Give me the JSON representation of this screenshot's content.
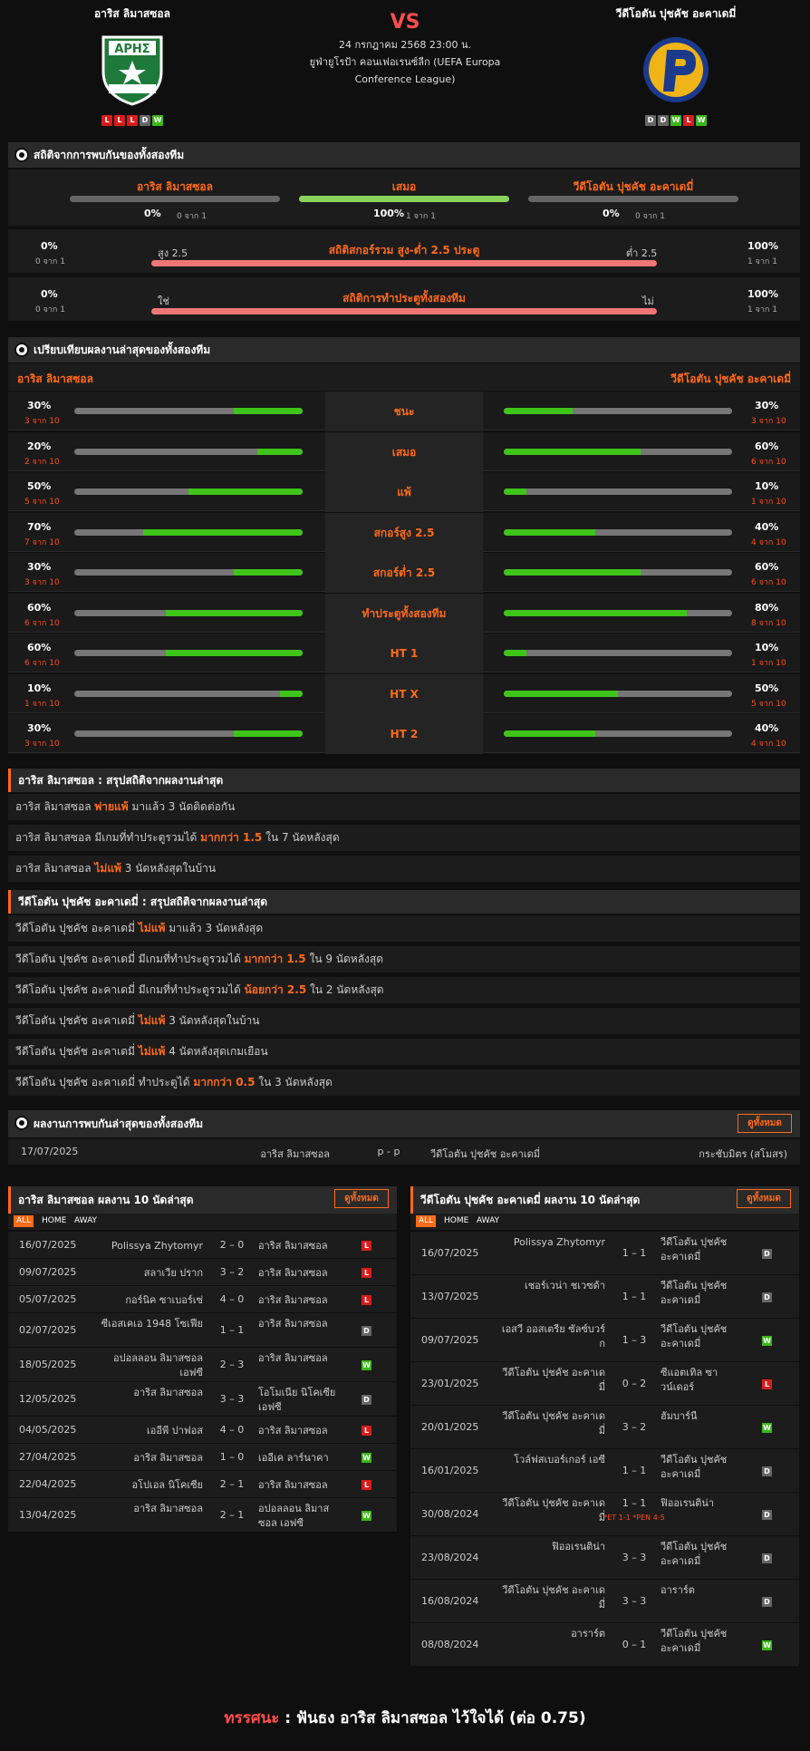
{
  "header": {
    "home": {
      "name": "อาริส ลิมาสซอล",
      "form": [
        "L",
        "L",
        "L",
        "D",
        "W"
      ]
    },
    "away": {
      "name": "วีดีโอตัน ปุชคัช อะคาเดมี่",
      "form": [
        "D",
        "D",
        "W",
        "L",
        "W"
      ]
    },
    "vs": "VS",
    "date": "24 กรกฎาคม 2568 23:00 น.",
    "league": "ยูฟ่ายูโรป้า คอนเฟอเรนซ์ลีก (UEFA Europa Conference League)"
  },
  "h2h_stats": {
    "title": "สถิติจากการพบกันของทั้งสองทีม",
    "cols": [
      {
        "label": "อาริส ลิมาสซอล",
        "pct": "0%",
        "sub": "0 จาก 1",
        "value": 0
      },
      {
        "label": "เสมอ",
        "pct": "100%",
        "sub": "1 จาก 1",
        "value": 1
      },
      {
        "label": "วีดีโอตัน ปุชคัช อะคาเดมี่",
        "pct": "0%",
        "sub": "0 จาก 1",
        "value": 0
      }
    ],
    "ou": {
      "title": "สถิติสกอร์รวม สูง-ต่ำ 2.5 ประตู",
      "left_pct": "0%",
      "left_sub": "0 จาก 1",
      "left_label": "สูง 2.5",
      "right_label": "ต่ำ 2.5",
      "right_pct": "100%",
      "right_sub": "1 จาก 1"
    },
    "btts": {
      "title": "สถิติการทำประตูทั้งสองทีม",
      "left_pct": "0%",
      "left_sub": "0 จาก 1",
      "left_label": "ใช่",
      "right_label": "ไม่",
      "right_pct": "100%",
      "right_sub": "1 จาก 1"
    }
  },
  "compare": {
    "title": "เปรียบเทียบผลงานล่าสุดของทั้งสองทีม",
    "home": "อาริส ลิมาสซอล",
    "away": "วีดีโอตัน ปุชคัช อะคาเดมี่",
    "rows": [
      {
        "label": "ชนะ",
        "home_pct": "30%",
        "home_sub": "3 จาก 10",
        "home": 0.3,
        "away_pct": "30%",
        "away_sub": "3 จาก 10",
        "away": 0.3
      },
      {
        "label": "เสมอ",
        "home_pct": "20%",
        "home_sub": "2 จาก 10",
        "home": 0.2,
        "away_pct": "60%",
        "away_sub": "6 จาก 10",
        "away": 0.6
      },
      {
        "label": "แพ้",
        "home_pct": "50%",
        "home_sub": "5 จาก 10",
        "home": 0.5,
        "away_pct": "10%",
        "away_sub": "1 จาก 10",
        "away": 0.1
      },
      {
        "label": "สกอร์สูง 2.5",
        "home_pct": "70%",
        "home_sub": "7 จาก 10",
        "home": 0.7,
        "away_pct": "40%",
        "away_sub": "4 จาก 10",
        "away": 0.4
      },
      {
        "label": "สกอร์ต่ำ 2.5",
        "home_pct": "30%",
        "home_sub": "3 จาก 10",
        "home": 0.3,
        "away_pct": "60%",
        "away_sub": "6 จาก 10",
        "away": 0.6
      },
      {
        "label": "ทำประตูทั้งสองทีม",
        "home_pct": "60%",
        "home_sub": "6 จาก 10",
        "home": 0.6,
        "away_pct": "80%",
        "away_sub": "8 จาก 10",
        "away": 0.8
      },
      {
        "label": "HT 1",
        "home_pct": "60%",
        "home_sub": "6 จาก 10",
        "home": 0.6,
        "away_pct": "10%",
        "away_sub": "1 จาก 10",
        "away": 0.1
      },
      {
        "label": "HT X",
        "home_pct": "10%",
        "home_sub": "1 จาก 10",
        "home": 0.1,
        "away_pct": "50%",
        "away_sub": "5 จาก 10",
        "away": 0.5
      },
      {
        "label": "HT 2",
        "home_pct": "30%",
        "home_sub": "3 จาก 10",
        "home": 0.3,
        "away_pct": "40%",
        "away_sub": "4 จาก 10",
        "away": 0.4
      }
    ]
  },
  "home_summary": {
    "title": "อาริส ลิมาสซอล : สรุปสถิติจากผลงานล่าสุด",
    "rows": [
      [
        "อาริส ลิมาสซอล ",
        "พ่ายแพ้",
        " มาแล้ว 3 นัดติดต่อกัน"
      ],
      [
        "อาริส ลิมาสซอล  มีเกมที่ทำประตูรวมได้ ",
        "มากกว่า 1.5",
        " ใน 7 นัดหลังสุด"
      ],
      [
        "อาริส ลิมาสซอล ",
        "ไม่แพ้",
        " 3  นัดหลังสุดในบ้าน"
      ]
    ]
  },
  "away_summary": {
    "title": "วีดีโอตัน ปุชคัช อะคาเดมี่ : สรุปสถิติจากผลงานล่าสุด",
    "rows": [
      [
        "วีดีโอตัน ปุชคัช อะคาเดมี่ ",
        "ไม่แพ้",
        " มาแล้ว 3 นัดหลังสุด"
      ],
      [
        "วีดีโอตัน ปุชคัช อะคาเดมี่  มีเกมที่ทำประตูรวมได้ ",
        "มากกว่า 1.5",
        " ใน 9 นัดหลังสุด"
      ],
      [
        "วีดีโอตัน ปุชคัช อะคาเดมี่  มีเกมที่ทำประตูรวมได้ ",
        "น้อยกว่า 2.5",
        " ใน 2 นัดหลังสุด"
      ],
      [
        "วีดีโอตัน ปุชคัช อะคาเดมี่ ",
        "ไม่แพ้",
        " 3  นัดหลังสุดในบ้าน"
      ],
      [
        "วีดีโอตัน ปุชคัช อะคาเดมี่ ",
        "ไม่แพ้",
        " 4  นัดหลังสุดเกมเยือน"
      ],
      [
        "วีดีโอตัน ปุชคัช อะคาเดมี่  ทำประตูได้ ",
        "มากกว่า 0.5",
        " ใน 3 นัดหลังสุด"
      ]
    ]
  },
  "h2h_results": {
    "title": "ผลงานการพบกันล่าสุดของทั้งสองทีม",
    "button": "ดูทั้งหมด",
    "row": {
      "date": "17/07/2025",
      "home": "อาริส ลิมาสซอล",
      "score": "p - p",
      "away": "วีดีโอตัน ปุชคัช อะคาเดมี่",
      "comp": "กระชับมิตร (สโมสร)"
    }
  },
  "home_last10": {
    "title": "อาริส ลิมาสซอล ผลงาน 10 นัดล่าสุด",
    "button": "ดูทั้งหมด",
    "tabs": [
      "ALL",
      "HOME",
      "AWAY"
    ],
    "rows": [
      {
        "date": "16/07/2025",
        "home": "Polissya Zhytomyr",
        "score": "2 – 0",
        "away": "อาริส ลิมาสซอล",
        "res": "L"
      },
      {
        "date": "09/07/2025",
        "home": "สลาเวีย ปราก",
        "score": "3 – 2",
        "away": "อาริส ลิมาสซอล",
        "res": "L"
      },
      {
        "date": "05/07/2025",
        "home": "กอร์นิค ซาเบอร์เซ่",
        "score": "4 – 0",
        "away": "อาริส ลิมาสซอล",
        "res": "L"
      },
      {
        "date": "02/07/2025",
        "home": "ซีเอสเคเอ 1948 โซเฟีย",
        "score": "1 – 1",
        "away": "อาริส ลิมาสซอล",
        "res": "D"
      },
      {
        "date": "18/05/2025",
        "home": "อปอลลอน ลิมาสซอล เอฟซี",
        "score": "2 – 3",
        "away": "อาริส ลิมาสซอล",
        "res": "W"
      },
      {
        "date": "12/05/2025",
        "home": "อาริส ลิมาสซอล",
        "score": "3 – 3",
        "away": "โอโมเนีย นิโคเซีย เอฟซี",
        "res": "D"
      },
      {
        "date": "04/05/2025",
        "home": "เออีพี ปาฟอส",
        "score": "4 – 0",
        "away": "อาริส ลิมาสซอล",
        "res": "L"
      },
      {
        "date": "27/04/2025",
        "home": "อาริส ลิมาสซอล",
        "score": "1 – 0",
        "away": "เออีเค ลาร์นาคา",
        "res": "W"
      },
      {
        "date": "22/04/2025",
        "home": "อโปเอล นิโคเซีย",
        "score": "2 – 1",
        "away": "อาริส ลิมาสซอล",
        "res": "L"
      },
      {
        "date": "13/04/2025",
        "home": "อาริส ลิมาสซอล",
        "score": "2 – 1",
        "away": "อปอลลอน ลิมาสซอล เอฟซี",
        "res": "W"
      }
    ]
  },
  "away_last10": {
    "title": "วีดีโอตัน ปุชคัช อะคาเดมี่ ผลงาน 10 นัดล่าสุด",
    "button": "ดูทั้งหมด",
    "tabs": [
      "ALL",
      "HOME",
      "AWAY"
    ],
    "rows": [
      {
        "date": "16/07/2025",
        "home": "Polissya Zhytomyr",
        "score": "1 – 1",
        "away": "วีดีโอตัน ปุชคัช อะคาเดมี่",
        "res": "D"
      },
      {
        "date": "13/07/2025",
        "home": "เชอร์เวน่า ชเวซด้า",
        "score": "1 – 1",
        "away": "วีดีโอตัน ปุชคัช อะคาเดมี่",
        "res": "D"
      },
      {
        "date": "09/07/2025",
        "home": "เอสวี ออสเตรีย ซัลซ์บวร์ก",
        "score": "1 – 3",
        "away": "วีดีโอตัน ปุชคัช อะคาเดมี่",
        "res": "W"
      },
      {
        "date": "23/01/2025",
        "home": "วีดีโอตัน ปุชคัช อะคาเดมี่",
        "score": "0 – 2",
        "away": "ซีแอตเทิล ซาวน์เดอร์",
        "res": "L"
      },
      {
        "date": "20/01/2025",
        "home": "วีดีโอตัน ปุชคัช อะคาเดมี่",
        "score": "3 – 2",
        "away": "ฮัมบาร์นี",
        "res": "W"
      },
      {
        "date": "16/01/2025",
        "home": "โวล์ฟสเบอร์เกอร์ เอซี",
        "score": "1 – 1",
        "away": "วีดีโอตัน ปุชคัช อะคาเดมี่",
        "res": "D"
      },
      {
        "date": "30/08/2024",
        "home": "วีดีโอตัน ปุชคัช อะคาเดมี่",
        "score": "1 – 1",
        "note": "*ET 1-1 *PEN 4-5",
        "away": "ฟิออเรนติน่า",
        "res": "D"
      },
      {
        "date": "23/08/2024",
        "home": "ฟิออเรนติน่า",
        "score": "3 – 3",
        "away": "วีดีโอตัน ปุชคัช อะคาเดมี่",
        "res": "D"
      },
      {
        "date": "16/08/2024",
        "home": "วีดีโอตัน ปุชคัช อะคาเดมี่",
        "score": "3 – 3",
        "away": "อาราร์ต",
        "res": "D"
      },
      {
        "date": "08/08/2024",
        "home": "อาราร์ต",
        "score": "0 – 1",
        "away": "วีดีโอตัน ปุชคัช อะคาเดมี่",
        "res": "W"
      }
    ]
  },
  "prediction": {
    "label": "ทรรศนะ",
    "sep": " : ",
    "text": "ฟันธง อาริส ลิมาสซอล ไว้ใจได้ (ต่อ 0.75)"
  }
}
